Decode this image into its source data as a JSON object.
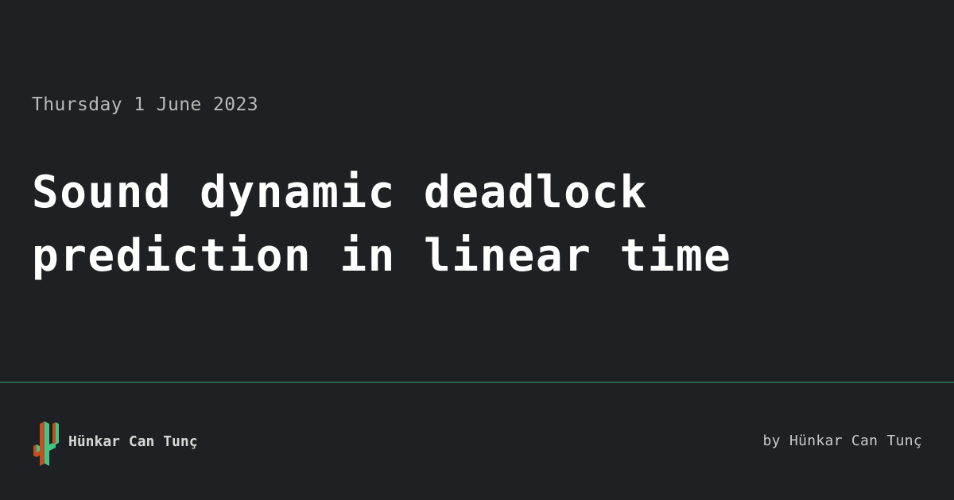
{
  "post": {
    "date": "Thursday 1 June 2023",
    "title": "Sound dynamic deadlock prediction in linear time"
  },
  "footer": {
    "author_name": "Hünkar Can Tunç",
    "byline": "by Hünkar Can Tunç",
    "logo_icon": "cactus-logo-icon"
  },
  "colors": {
    "background": "#1f2023",
    "divider": "#3f9e7c",
    "logo_green": "#43c489",
    "logo_orange": "#c1501f"
  }
}
